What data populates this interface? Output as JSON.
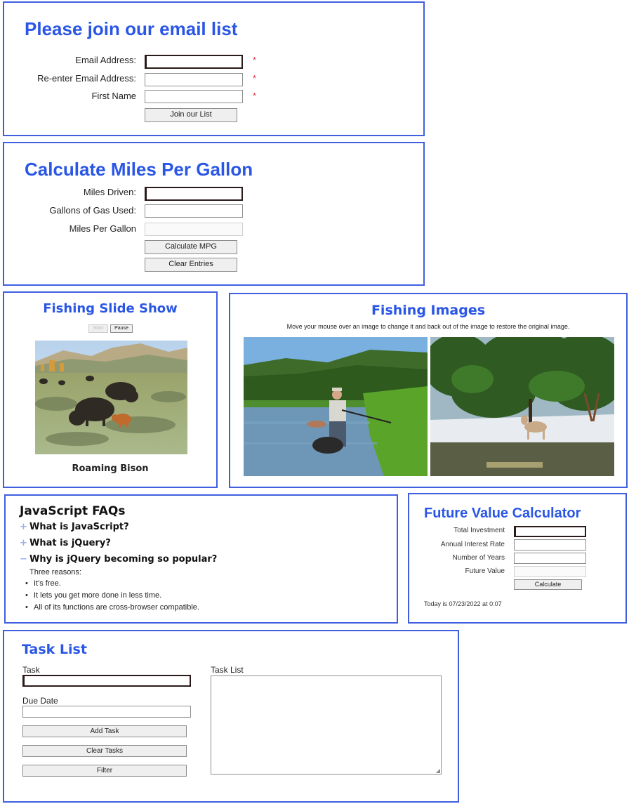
{
  "email_form": {
    "title": "Please join our email list",
    "email_label": "Email Address:",
    "reenter_label": "Re-enter Email Address:",
    "first_name_label": "First Name",
    "required_mark": "*",
    "submit_label": "Join our List"
  },
  "mpg": {
    "title": "Calculate Miles Per Gallon",
    "miles_label": "Miles Driven:",
    "gallons_label": "Gallons of Gas Used:",
    "mpg_label": "Miles Per Gallon",
    "calc_label": "Calculate MPG",
    "clear_label": "Clear Entries"
  },
  "slideshow": {
    "title": "Fishing Slide Show",
    "prev_label": "Start",
    "pause_label": "Pause",
    "caption": "Roaming Bison"
  },
  "fishing_images": {
    "title": "Fishing Images",
    "instructions": "Move your mouse over an image to change it and back out of the image to restore the original image."
  },
  "faq": {
    "title": "JavaScript FAQs",
    "items": [
      {
        "marker": "+",
        "question": "What is JavaScript?"
      },
      {
        "marker": "+",
        "question": "What is jQuery?"
      },
      {
        "marker": "−",
        "question": "Why is jQuery becoming so popular?"
      }
    ],
    "answer_intro": "Three reasons:",
    "reasons": [
      "It's free.",
      "It lets you get more done in less time.",
      "All of its functions are cross-browser compatible."
    ]
  },
  "future_value": {
    "title": "Future Value Calculator",
    "investment_label": "Total Investment",
    "rate_label": "Annual Interest Rate",
    "years_label": "Number of Years",
    "fv_label": "Future Value",
    "calc_label": "Calculate",
    "today_text": "Today is 07/23/2022 at 0:07"
  },
  "tasks": {
    "title": "Task List",
    "task_label": "Task",
    "due_label": "Due Date",
    "list_label": "Task List",
    "add_label": "Add Task",
    "clear_label": "Clear Tasks",
    "filter_label": "Filter"
  },
  "colors": {
    "heading_blue": "#2a56e6",
    "panel_border": "#3f5fe0",
    "required_red": "#e0304a"
  }
}
